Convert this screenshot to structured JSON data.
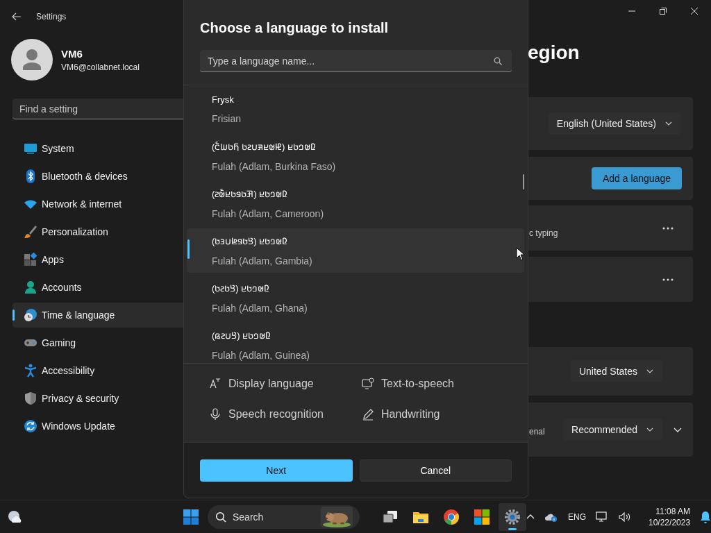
{
  "window": {
    "title": "Settings"
  },
  "account": {
    "name": "VM6",
    "email": "VM6@collabnet.local"
  },
  "search": {
    "placeholder": "Find a setting"
  },
  "nav": [
    {
      "label": "System",
      "selected": false
    },
    {
      "label": "Bluetooth & devices",
      "selected": false
    },
    {
      "label": "Network & internet",
      "selected": false
    },
    {
      "label": "Personalization",
      "selected": false
    },
    {
      "label": "Apps",
      "selected": false
    },
    {
      "label": "Accounts",
      "selected": false
    },
    {
      "label": "Time & language",
      "selected": true
    },
    {
      "label": "Gaming",
      "selected": false
    },
    {
      "label": "Accessibility",
      "selected": false
    },
    {
      "label": "Privacy & security",
      "selected": false
    },
    {
      "label": "Windows Update",
      "selected": false
    }
  ],
  "page": {
    "title": "egion",
    "cards": [
      {
        "kind": "dropdown",
        "value": "English (United States)"
      },
      {
        "kind": "button",
        "label": "Add a language"
      },
      {
        "kind": "more",
        "text": "c typing"
      },
      {
        "kind": "more"
      },
      {
        "kind": "dropdown",
        "value": "United States"
      },
      {
        "kind": "expand",
        "text": "enal",
        "value": "Recommended"
      }
    ]
  },
  "dialog": {
    "title": "Choose a language to install",
    "search": {
      "placeholder": "Type a language name..."
    },
    "languages": [
      {
        "native": "Frysk",
        "english": "Frisian",
        "selected": false
      },
      {
        "native": "𞤆𞤵𞤤𞤢𞤪 (𞤄𞤵𞤪𞤳𞤭𞤲𞤢 𞤊𞤢𞤧𞤮𞥅)",
        "english": "Fulah (Adlam, Burkina Faso)",
        "selected": false
      },
      {
        "native": "𞤆𞤵𞤤𞤢𞤪 (𞤑𞤢𞤥𞤢𞤪𞤵𞥅𞤲)",
        "english": "Fulah (Adlam, Cameroon)",
        "selected": false
      },
      {
        "native": "𞤆𞤵𞤤𞤢𞤪 (𞤘𞤢𞤥𞤦𞤭𞤴𞤢)",
        "english": "Fulah (Adlam, Gambia)",
        "selected": true
      },
      {
        "native": "𞤆𞤵𞤤𞤢𞤪 (𞤘𞤢𞤲𞤢)",
        "english": "Fulah (Adlam, Ghana)",
        "selected": false
      },
      {
        "native": "𞤆𞤵𞤤𞤢𞤪 (𞤘𞤭𞤲𞤫)",
        "english": "Fulah (Adlam, Guinea)",
        "selected": false
      }
    ],
    "features": [
      {
        "label": "Display language"
      },
      {
        "label": "Text-to-speech"
      },
      {
        "label": "Speech recognition"
      },
      {
        "label": "Handwriting"
      }
    ],
    "buttons": [
      {
        "label": "Next",
        "kind": "primary"
      },
      {
        "label": "Cancel",
        "kind": "secondary"
      }
    ]
  },
  "taskbar": {
    "search_placeholder": "Search",
    "apps": [
      {
        "active": false
      },
      {
        "active": false
      },
      {
        "active": false
      },
      {
        "active": false
      },
      {
        "active": true
      }
    ],
    "language": "ENG",
    "time": "11:08 AM",
    "date": "10/22/2023"
  }
}
